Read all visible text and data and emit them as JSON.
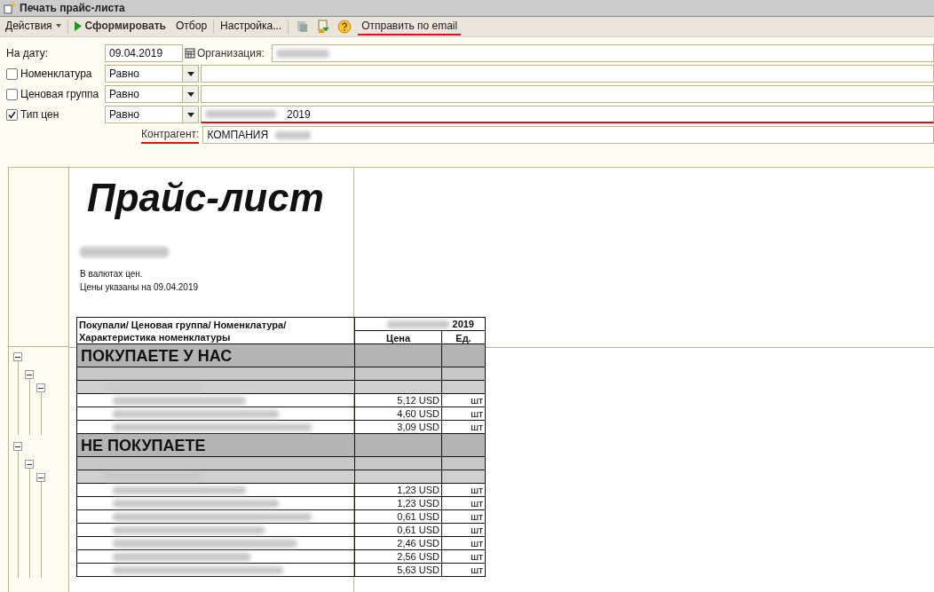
{
  "window": {
    "title": "Печать прайс-листа"
  },
  "toolbar": [
    {
      "kind": "menu",
      "label": "Действия",
      "highlighted": false
    },
    {
      "kind": "run",
      "label": "Сформировать",
      "highlighted": false
    },
    {
      "kind": "text",
      "label": "Отбор",
      "highlighted": false
    },
    {
      "kind": "text",
      "label": "Настройка...",
      "highlighted": false
    },
    {
      "kind": "icons"
    },
    {
      "kind": "link",
      "label": "Отправить по email",
      "highlighted": true
    }
  ],
  "form": {
    "date_label": "На дату:",
    "date_value": "09.04.2019",
    "org_label": "Организация:",
    "filters": [
      {
        "label": "Номенклатура",
        "checked": false,
        "condition": "Равно",
        "highlighted": false
      },
      {
        "label": "Ценовая группа",
        "checked": false,
        "condition": "Равно",
        "highlighted": false
      },
      {
        "label": "Тип цен",
        "checked": true,
        "condition": "Равно",
        "value": "2019",
        "highlighted": true
      }
    ],
    "contractor_label": "Контрагент:",
    "contractor_value": "КОМПАНИЯ",
    "contractor_highlighted": true
  },
  "report": {
    "title": "Прайс-лист",
    "notes": [
      "В валютах цен.",
      "Цены указаны на 09.04.2019"
    ],
    "header": {
      "name": "Покупали/ Ценовая группа/ Номенклатура/ Характеристика номенклатуры",
      "price_type": "2019",
      "price": "Цена",
      "unit": "Ед."
    },
    "sections": [
      {
        "title": "ПОКУПАЕТЕ У НАС",
        "rows": [
          {
            "price": "5,12 USD",
            "unit": "шт"
          },
          {
            "price": "4,60 USD",
            "unit": "шт"
          },
          {
            "price": "3,09 USD",
            "unit": "шт"
          }
        ]
      },
      {
        "title": "НЕ ПОКУПАЕТЕ",
        "rows": [
          {
            "price": "1,23 USD",
            "unit": "шт"
          },
          {
            "price": "1,23 USD",
            "unit": "шт"
          },
          {
            "price": "0,61 USD",
            "unit": "шт"
          },
          {
            "price": "0,61 USD",
            "unit": "шт"
          },
          {
            "price": "2,46 USD",
            "unit": "шт"
          },
          {
            "price": "2,56 USD",
            "unit": "шт"
          },
          {
            "price": "5,63 USD",
            "unit": "шт"
          }
        ]
      }
    ]
  }
}
